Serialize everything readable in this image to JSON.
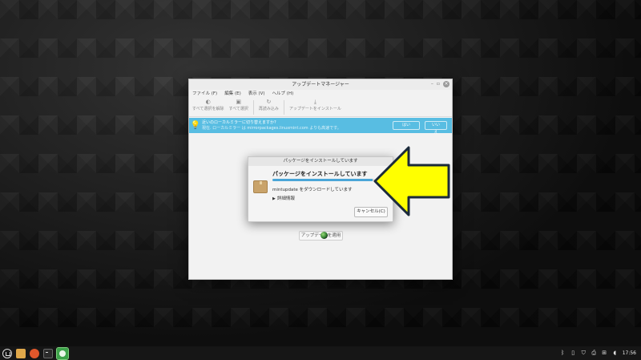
{
  "window": {
    "title": "アップデートマネージャー",
    "controls": {
      "minimize": "–",
      "maximize": "▫",
      "close": "×"
    },
    "menu": [
      "ファイル (F)",
      "編集 (E)",
      "表示 (V)",
      "ヘルプ (H)"
    ],
    "toolbar": [
      {
        "label": "すべて選択を解除",
        "icon": "deselect-icon",
        "glyph": "◐"
      },
      {
        "label": "すべて選択",
        "icon": "select-all-icon",
        "glyph": "▣"
      },
      {
        "label": "再読み込み",
        "icon": "refresh-icon",
        "glyph": "↻"
      },
      {
        "label": "アップデートをインストール",
        "icon": "install-icon",
        "glyph": "⤓"
      }
    ],
    "infobar": {
      "line1": "近いのローカルミラーに切り替えますか?",
      "line2": "現在. ローカルミラー は mirrorpackages.linuxmint.com よりも高速です。",
      "yes": "はい",
      "no": "いいえ"
    },
    "apply_button": "アップデートを適用"
  },
  "dialog": {
    "title": "パッケージをインストールしています",
    "heading": "パッケージをインストールしています",
    "progress": 0.98,
    "status": "mintupdate をダウンロードしています",
    "details": "詳細情報",
    "cancel": "キャンセル(C)"
  },
  "annotation": {
    "arrow_fill": "#ffff00",
    "arrow_stroke": "#1b2a3a"
  },
  "taskbar": {
    "apps": [
      "menu-icon",
      "files-icon",
      "firefox-icon",
      "terminal-icon",
      "update-manager-icon"
    ],
    "tray": [
      "bluetooth-icon",
      "clipboard-icon",
      "shield-icon",
      "printer-icon",
      "network-icon",
      "volume-icon"
    ],
    "clock": "17:56"
  }
}
